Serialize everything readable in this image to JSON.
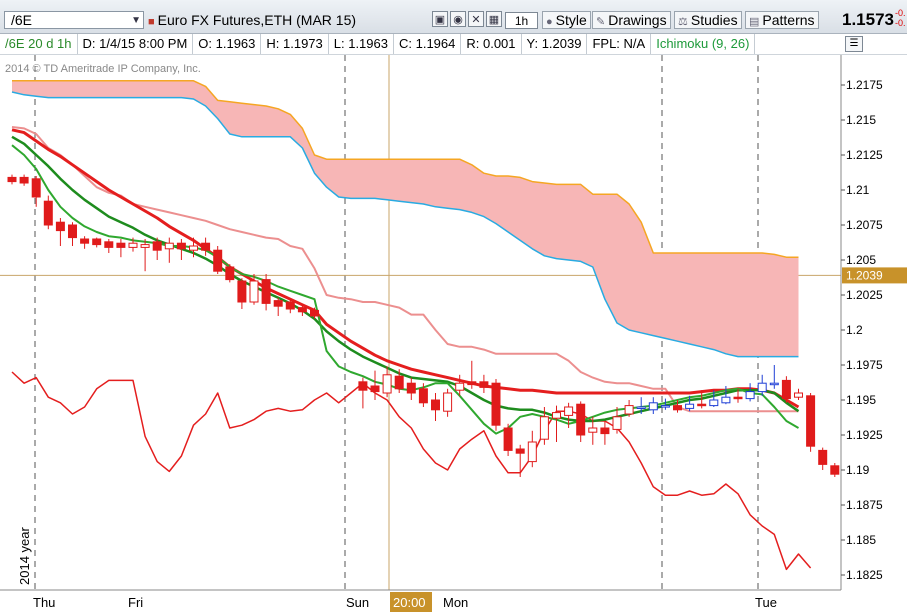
{
  "toolbar": {
    "symbol": "/6E",
    "description": "Euro FX Futures,ETH (MAR 15)",
    "aggregation": "1h",
    "style_label": "Style",
    "drawings_label": "Drawings",
    "studies_label": "Studies",
    "patterns_label": "Patterns",
    "last_price": "1.1573",
    "change_top": "-0.",
    "change_bottom": "-0."
  },
  "infobar": {
    "symbol_period": "/6E 20 d 1h",
    "date": "D: 1/4/15 8:00 PM",
    "open": "O: 1.1963",
    "high": "H: 1.1973",
    "low": "L: 1.1963",
    "close": "C: 1.1964",
    "range": "R: 0.001",
    "y": "Y: 1.2039",
    "fpl": "FPL: N/A",
    "study": "Ichimoku (9, 26)"
  },
  "chart": {
    "watermark": "2014 © TD Ameritrade IP Company, Inc.",
    "year_label": "2014 year",
    "crosshair_price": "1.2039",
    "crosshair_time": "20:00",
    "day_labels": [
      "Thu",
      "Fri",
      "Sun",
      "Mon",
      "Tue"
    ]
  },
  "chart_data": {
    "type": "candlestick",
    "ylim": [
      1.181,
      1.219
    ],
    "y_ticks": [
      "1.2175",
      "1.215",
      "1.2125",
      "1.21",
      "1.2075",
      "1.205",
      "1.2025",
      "1.2",
      "1.1975",
      "1.195",
      "1.1925",
      "1.19",
      "1.1875",
      "1.185",
      "1.1825"
    ],
    "x_labels": [
      "Thu",
      "Fri",
      "Sun",
      "Mon",
      "Tue"
    ],
    "crosshair_y": 1.2039,
    "candles": [
      {
        "o": 1.2109,
        "c": 1.2106,
        "h": 1.2111,
        "l": 1.2104
      },
      {
        "o": 1.2109,
        "c": 1.2105,
        "h": 1.2111,
        "l": 1.2103
      },
      {
        "o": 1.2108,
        "c": 1.2095,
        "h": 1.211,
        "l": 1.2088
      },
      {
        "o": 1.2092,
        "c": 1.2075,
        "h": 1.2096,
        "l": 1.2072
      },
      {
        "o": 1.2077,
        "c": 1.2071,
        "h": 1.208,
        "l": 1.206
      },
      {
        "o": 1.2075,
        "c": 1.2066,
        "h": 1.2077,
        "l": 1.206
      },
      {
        "o": 1.2065,
        "c": 1.2062,
        "h": 1.2067,
        "l": 1.2058
      },
      {
        "o": 1.2065,
        "c": 1.2061,
        "h": 1.2066,
        "l": 1.2059
      },
      {
        "o": 1.2063,
        "c": 1.2059,
        "h": 1.2065,
        "l": 1.2055
      },
      {
        "o": 1.2062,
        "c": 1.2059,
        "h": 1.2065,
        "l": 1.2052
      },
      {
        "o": 1.2059,
        "c": 1.2062,
        "h": 1.2066,
        "l": 1.2056
      },
      {
        "o": 1.2059,
        "c": 1.2061,
        "h": 1.2065,
        "l": 1.2042
      },
      {
        "o": 1.2063,
        "c": 1.2057,
        "h": 1.2066,
        "l": 1.205
      },
      {
        "o": 1.2058,
        "c": 1.2062,
        "h": 1.2066,
        "l": 1.2048
      },
      {
        "o": 1.2062,
        "c": 1.2058,
        "h": 1.2065,
        "l": 1.205
      },
      {
        "o": 1.2057,
        "c": 1.206,
        "h": 1.2066,
        "l": 1.2052
      },
      {
        "o": 1.2062,
        "c": 1.2057,
        "h": 1.2066,
        "l": 1.2053
      },
      {
        "o": 1.2057,
        "c": 1.2042,
        "h": 1.206,
        "l": 1.204
      },
      {
        "o": 1.2045,
        "c": 1.2036,
        "h": 1.2047,
        "l": 1.2034
      },
      {
        "o": 1.2035,
        "c": 1.202,
        "h": 1.2037,
        "l": 1.2015
      },
      {
        "o": 1.202,
        "c": 1.2035,
        "h": 1.204,
        "l": 1.2018
      },
      {
        "o": 1.2036,
        "c": 1.2019,
        "h": 1.204,
        "l": 1.2014
      },
      {
        "o": 1.2021,
        "c": 1.2017,
        "h": 1.2023,
        "l": 1.201
      },
      {
        "o": 1.202,
        "c": 1.2015,
        "h": 1.2022,
        "l": 1.2012
      },
      {
        "o": 1.2016,
        "c": 1.2013,
        "h": 1.2018,
        "l": 1.201
      },
      {
        "o": 1.2014,
        "c": 1.201,
        "h": 1.2016,
        "l": 1.2008
      },
      {
        "o": 1.1963,
        "c": 1.1957,
        "h": 1.1966,
        "l": 1.1944
      },
      {
        "o": 1.196,
        "c": 1.1956,
        "h": 1.1971,
        "l": 1.195
      },
      {
        "o": 1.1955,
        "c": 1.1968,
        "h": 1.1974,
        "l": 1.1952
      },
      {
        "o": 1.1967,
        "c": 1.1958,
        "h": 1.1972,
        "l": 1.1955
      },
      {
        "o": 1.1962,
        "c": 1.1955,
        "h": 1.1966,
        "l": 1.195
      },
      {
        "o": 1.1958,
        "c": 1.1948,
        "h": 1.1962,
        "l": 1.1945
      },
      {
        "o": 1.195,
        "c": 1.1943,
        "h": 1.1955,
        "l": 1.1935
      },
      {
        "o": 1.1942,
        "c": 1.1955,
        "h": 1.1958,
        "l": 1.1938
      },
      {
        "o": 1.1957,
        "c": 1.1962,
        "h": 1.1968,
        "l": 1.1953
      },
      {
        "o": 1.1963,
        "c": 1.1961,
        "h": 1.1978,
        "l": 1.1958
      },
      {
        "o": 1.1963,
        "c": 1.1959,
        "h": 1.1968,
        "l": 1.1955
      },
      {
        "o": 1.1962,
        "c": 1.1932,
        "h": 1.1965,
        "l": 1.1928
      },
      {
        "o": 1.193,
        "c": 1.1914,
        "h": 1.1933,
        "l": 1.191
      },
      {
        "o": 1.1915,
        "c": 1.1912,
        "h": 1.1918,
        "l": 1.1895
      },
      {
        "o": 1.1906,
        "c": 1.192,
        "h": 1.1928,
        "l": 1.1902
      },
      {
        "o": 1.1922,
        "c": 1.1938,
        "h": 1.1945,
        "l": 1.1918
      },
      {
        "o": 1.1937,
        "c": 1.1941,
        "h": 1.1946,
        "l": 1.192
      },
      {
        "o": 1.1939,
        "c": 1.1945,
        "h": 1.1948,
        "l": 1.193
      },
      {
        "o": 1.1947,
        "c": 1.1925,
        "h": 1.1949,
        "l": 1.192
      },
      {
        "o": 1.1927,
        "c": 1.193,
        "h": 1.1938,
        "l": 1.1918
      },
      {
        "o": 1.193,
        "c": 1.1926,
        "h": 1.1935,
        "l": 1.1918
      },
      {
        "o": 1.1929,
        "c": 1.1938,
        "h": 1.1945,
        "l": 1.1926
      },
      {
        "o": 1.194,
        "c": 1.1946,
        "h": 1.195,
        "l": 1.1938
      },
      {
        "o": 1.1945,
        "c": 1.1945,
        "h": 1.1952,
        "l": 1.194
      },
      {
        "o": 1.1943,
        "c": 1.1948,
        "h": 1.1952,
        "l": 1.194
      },
      {
        "o": 1.1946,
        "c": 1.1946,
        "h": 1.1951,
        "l": 1.1943
      },
      {
        "o": 1.1946,
        "c": 1.1943,
        "h": 1.195,
        "l": 1.1941
      },
      {
        "o": 1.1944,
        "c": 1.1947,
        "h": 1.1953,
        "l": 1.1942
      },
      {
        "o": 1.1947,
        "c": 1.1946,
        "h": 1.1957,
        "l": 1.1944
      },
      {
        "o": 1.1946,
        "c": 1.195,
        "h": 1.1957,
        "l": 1.1945
      },
      {
        "o": 1.1948,
        "c": 1.1952,
        "h": 1.196,
        "l": 1.1947
      },
      {
        "o": 1.1952,
        "c": 1.1951,
        "h": 1.1958,
        "l": 1.1948
      },
      {
        "o": 1.1951,
        "c": 1.1956,
        "h": 1.1962,
        "l": 1.1949
      },
      {
        "o": 1.1956,
        "c": 1.1962,
        "h": 1.1968,
        "l": 1.1953
      },
      {
        "o": 1.1962,
        "c": 1.1962,
        "h": 1.1975,
        "l": 1.1958
      },
      {
        "o": 1.1964,
        "c": 1.1951,
        "h": 1.1967,
        "l": 1.1948
      },
      {
        "o": 1.1952,
        "c": 1.1955,
        "h": 1.1958,
        "l": 1.195
      },
      {
        "o": 1.1953,
        "c": 1.1917,
        "h": 1.1955,
        "l": 1.1913
      },
      {
        "o": 1.1914,
        "c": 1.1904,
        "h": 1.1916,
        "l": 1.19
      },
      {
        "o": 1.1903,
        "c": 1.1897,
        "h": 1.1905,
        "l": 1.1895
      }
    ],
    "conversion_line": [
      1.2132,
      1.2125,
      1.2115,
      1.21,
      1.2088,
      1.208,
      1.2074,
      1.207,
      1.2067,
      1.2066,
      1.2064,
      1.2063,
      1.2062,
      1.206,
      1.206,
      1.2059,
      1.2057,
      1.2052,
      1.2045,
      1.204,
      1.2038,
      1.2035,
      1.2031,
      1.2028,
      1.2025,
      1.2022,
      1.1985,
      1.1974,
      1.197,
      1.1967,
      1.1963,
      1.1961,
      1.1958,
      1.1957,
      1.1959,
      1.1962,
      1.1962,
      1.1953,
      1.1943,
      1.1933,
      1.1926,
      1.193,
      1.1938,
      1.194,
      1.1938,
      1.1936,
      1.1933,
      1.1935,
      1.1938,
      1.1941,
      1.1943,
      1.1944,
      1.1945,
      1.1946,
      1.1948,
      1.195,
      1.1952,
      1.1953,
      1.1955,
      1.1957,
      1.1958,
      1.1955,
      1.1954,
      1.1945,
      1.1935,
      1.193
    ],
    "base_line": [
      1.2138,
      1.2133,
      1.2125,
      1.2117,
      1.2108,
      1.21,
      1.2093,
      1.2087,
      1.2081,
      1.2077,
      1.2073,
      1.2068,
      1.2064,
      1.2061,
      1.2058,
      1.2055,
      1.2051,
      1.2046,
      1.204,
      1.2035,
      1.2031,
      1.2027,
      1.2023,
      1.2019,
      1.2014,
      1.2008,
      1.1999,
      1.1992,
      1.1986,
      1.1981,
      1.1977,
      1.1973,
      1.1969,
      1.1966,
      1.1965,
      1.1964,
      1.1963,
      1.196,
      1.1955,
      1.195,
      1.1946,
      1.1944,
      1.1943,
      1.1943,
      1.1941,
      1.1938,
      1.1936,
      1.1935,
      1.1935,
      1.1936,
      1.1938,
      1.194,
      1.1942,
      1.1944,
      1.1946,
      1.1948,
      1.195,
      1.1951,
      1.1953,
      1.1955,
      1.1957,
      1.1957,
      1.1957,
      1.1955,
      1.1948,
      1.1942
    ],
    "kumo_span_a": [
      1.2178,
      1.2178,
      1.2178,
      1.2178,
      1.2178,
      1.2178,
      1.2178,
      1.2178,
      1.2178,
      1.2178,
      1.2178,
      1.2178,
      1.2178,
      1.2178,
      1.2178,
      1.2178,
      1.2174,
      1.2164,
      1.2163,
      1.2162,
      1.2161,
      1.216,
      1.2158,
      1.2154,
      1.2144,
      1.2125,
      1.2122,
      1.2122,
      1.2122,
      1.2122,
      1.2122,
      1.2122,
      1.2122,
      1.2122,
      1.2122,
      1.2122,
      1.2122,
      1.2122,
      1.2118,
      1.2112,
      1.211,
      1.211,
      1.2109,
      1.2106,
      1.2105,
      1.2104,
      1.2104,
      1.2104,
      1.2097,
      1.2097,
      1.2097,
      1.209,
      1.2077,
      1.2055,
      1.2055,
      1.2055,
      1.2055,
      1.2055,
      1.2055,
      1.2055,
      1.2055,
      1.2055,
      1.2055,
      1.2054,
      1.2052,
      1.2052
    ],
    "kumo_span_b": [
      1.217,
      1.2168,
      1.2167,
      1.2166,
      1.2166,
      1.2166,
      1.2166,
      1.2166,
      1.2166,
      1.2166,
      1.2166,
      1.2166,
      1.2166,
      1.2166,
      1.2166,
      1.2165,
      1.216,
      1.2151,
      1.214,
      1.2138,
      1.2138,
      1.2138,
      1.2138,
      1.2138,
      1.213,
      1.2112,
      1.2102,
      1.2095,
      1.2094,
      1.2094,
      1.2094,
      1.2093,
      1.2092,
      1.2091,
      1.209,
      1.2088,
      1.2087,
      1.2086,
      1.2084,
      1.2081,
      1.2076,
      1.207,
      1.2064,
      1.2058,
      1.2053,
      1.2051,
      1.205,
      1.2049,
      1.2045,
      1.2022,
      1.2005,
      1.2,
      1.1998,
      1.1996,
      1.1994,
      1.1992,
      1.199,
      1.1988,
      1.1986,
      1.1983,
      1.1981,
      1.1981,
      1.1981,
      1.1981,
      1.1981,
      1.1981
    ],
    "lagging_span": [
      1.197,
      1.1962,
      1.1966,
      1.1952,
      1.1948,
      1.194,
      1.1945,
      1.1958,
      1.1964,
      1.1964,
      1.1964,
      1.1924,
      1.1906,
      1.1899,
      1.191,
      1.1932,
      1.194,
      1.1955,
      1.193,
      1.1932,
      1.1936,
      1.1942,
      1.1944,
      1.1942,
      1.1943,
      1.195,
      1.1955,
      1.1948,
      1.1955,
      1.1962,
      1.1955,
      1.195,
      1.1938,
      1.193,
      1.1915,
      1.1905,
      1.19,
      1.1915,
      1.1922,
      1.1928,
      1.191,
      1.1898,
      1.1898,
      1.191,
      1.1928,
      1.1942,
      1.1942,
      1.194,
      1.1935,
      1.1935,
      1.193,
      1.192,
      1.1905,
      1.1888,
      1.1882,
      1.1882,
      1.1885,
      1.1882,
      1.1883,
      1.189,
      1.1883,
      1.1868,
      1.186,
      1.1854,
      1.1829,
      1.184,
      1.183
    ],
    "red_trend_line": [
      1.2143,
      1.2141,
      1.2135,
      1.2129,
      1.2124,
      1.2118,
      1.2112,
      1.2106,
      1.21,
      1.2095,
      1.209,
      1.2085,
      1.208,
      1.2074,
      1.2069,
      1.2064,
      1.2058,
      1.2052,
      1.2045,
      1.204,
      1.2035,
      1.203,
      1.2026,
      1.2022,
      1.2018,
      1.2014,
      1.2004,
      1.1998,
      1.1992,
      1.1987,
      1.1982,
      1.1978,
      1.1975,
      1.1972,
      1.197,
      1.1968,
      1.1966,
      1.1964,
      1.1962,
      1.196,
      1.1959,
      1.1958,
      1.1957,
      1.1957,
      1.1956,
      1.1955,
      1.1955,
      1.1955,
      1.1955,
      1.1955,
      1.1955,
      1.1955,
      1.1955,
      1.1955,
      1.1955,
      1.1955,
      1.1955,
      1.1956,
      1.1957,
      1.1957,
      1.1958,
      1.1958,
      1.1957,
      1.1955,
      1.195,
      1.1945
    ],
    "pink_lagging": [
      1.2145,
      1.2144,
      1.214,
      1.213,
      1.2125,
      1.2118,
      1.211,
      1.2102,
      1.2098,
      1.2096,
      1.209,
      1.2088,
      1.2086,
      1.2084,
      1.2082,
      1.208,
      1.2078,
      1.2075,
      1.2072,
      1.207,
      1.2068,
      1.2066,
      1.2065,
      1.206,
      1.2058,
      1.2044,
      1.2025,
      1.2023,
      1.2022,
      1.202,
      1.202,
      1.2018,
      1.2016,
      1.2011,
      1.2011,
      1.2,
      1.199,
      1.1988,
      1.1988,
      1.1986,
      1.1983,
      1.1983,
      1.1983,
      1.1983,
      1.1983,
      1.1983,
      1.1978,
      1.197,
      1.1966,
      1.1963,
      1.1962,
      1.1962,
      1.196,
      1.1958,
      1.1958,
      1.1945,
      1.1942,
      1.1942,
      1.1942,
      1.1942,
      1.1942,
      1.1942,
      1.1942,
      1.1942,
      1.1942,
      1.1942
    ]
  }
}
